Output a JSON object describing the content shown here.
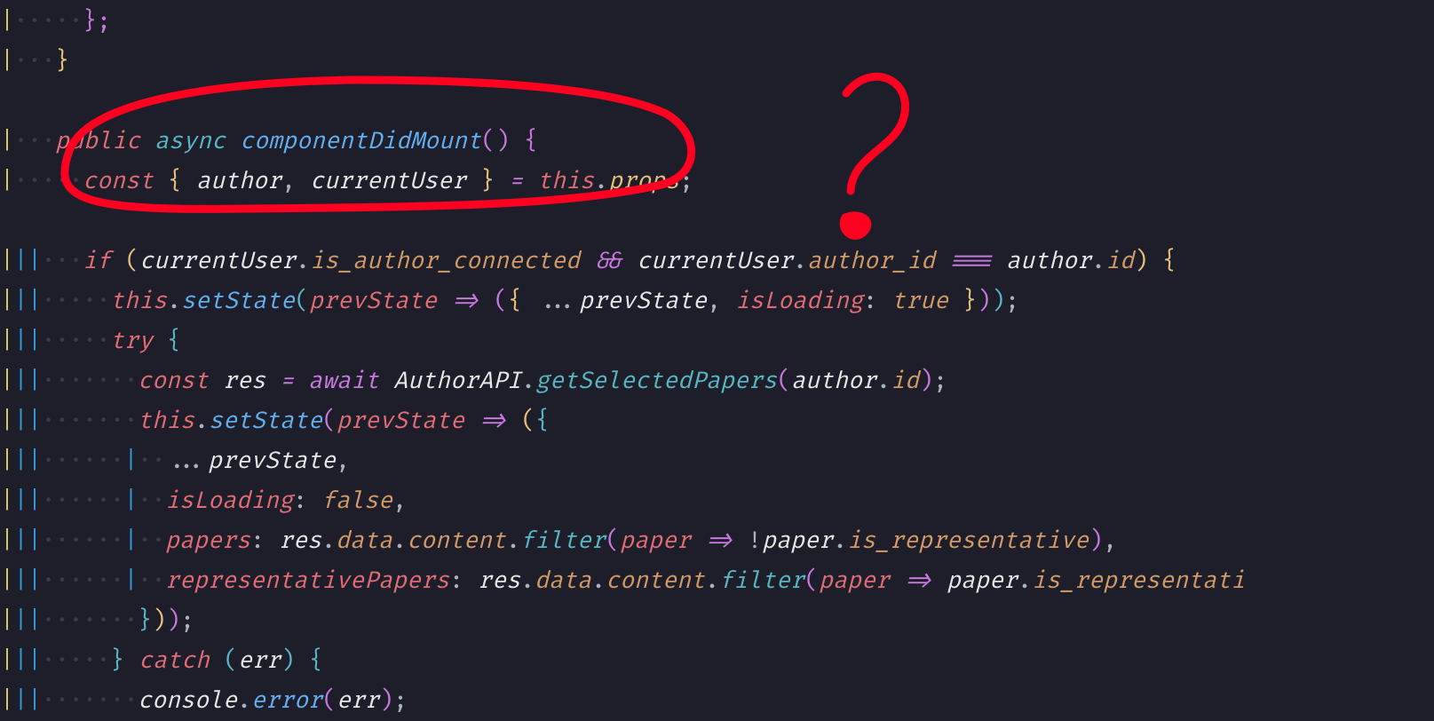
{
  "annotation": {
    "color": "#ff0020"
  },
  "code": {
    "lines": [
      {
        "indent": 3,
        "guides": "y   ",
        "tokens": [
          {
            "t": "};",
            "c": "brace-p"
          }
        ]
      },
      {
        "indent": 2,
        "guides": "y",
        "tokens": [
          {
            "t": "}",
            "c": "brace-y"
          }
        ]
      },
      {
        "indent": 0,
        "guides": "",
        "tokens": []
      },
      {
        "indent": 2,
        "guides": "y",
        "tokens": [
          {
            "t": "public",
            "c": "kw"
          },
          {
            "t": " ",
            "c": "plain"
          },
          {
            "t": "async",
            "c": "storage"
          },
          {
            "t": " ",
            "c": "plain"
          },
          {
            "t": "componentDidMount",
            "c": "fn"
          },
          {
            "t": "()",
            "c": "brace-p"
          },
          {
            "t": " ",
            "c": "plain"
          },
          {
            "t": "{",
            "c": "brace-p"
          }
        ]
      },
      {
        "indent": 3,
        "guides": "y   ",
        "tokens": [
          {
            "t": "const",
            "c": "kw"
          },
          {
            "t": " ",
            "c": "plain"
          },
          {
            "t": "{",
            "c": "brace-y"
          },
          {
            "t": " ",
            "c": "plain"
          },
          {
            "t": "author",
            "c": "white"
          },
          {
            "t": ",",
            "c": "punct"
          },
          {
            "t": " ",
            "c": "plain"
          },
          {
            "t": "currentUser",
            "c": "white"
          },
          {
            "t": " ",
            "c": "plain"
          },
          {
            "t": "}",
            "c": "brace-y"
          },
          {
            "t": " ",
            "c": "plain"
          },
          {
            "t": "=",
            "c": "kw2"
          },
          {
            "t": " ",
            "c": "plain"
          },
          {
            "t": "this",
            "c": "kw"
          },
          {
            "t": ".",
            "c": "punct"
          },
          {
            "t": "props",
            "c": "prop"
          },
          {
            "t": ";",
            "c": "punct"
          }
        ]
      },
      {
        "indent": 0,
        "guides": "",
        "tokens": []
      },
      {
        "indent": 3,
        "guides": "ybb ",
        "tokens": [
          {
            "t": "if",
            "c": "kw"
          },
          {
            "t": " ",
            "c": "plain"
          },
          {
            "t": "(",
            "c": "brace-y"
          },
          {
            "t": "currentUser",
            "c": "white"
          },
          {
            "t": ".",
            "c": "punct"
          },
          {
            "t": "is_author_connected",
            "c": "var"
          },
          {
            "t": " ",
            "c": "plain"
          },
          {
            "t": "&&",
            "c": "kw2"
          },
          {
            "t": " ",
            "c": "plain"
          },
          {
            "t": "currentUser",
            "c": "white"
          },
          {
            "t": ".",
            "c": "punct"
          },
          {
            "t": "author_id",
            "c": "var"
          },
          {
            "t": " ",
            "c": "plain"
          },
          {
            "t": "===",
            "c": "kw2"
          },
          {
            "t": " ",
            "c": "plain"
          },
          {
            "t": "author",
            "c": "white"
          },
          {
            "t": ".",
            "c": "punct"
          },
          {
            "t": "id",
            "c": "var"
          },
          {
            "t": ")",
            "c": "brace-y"
          },
          {
            "t": " ",
            "c": "plain"
          },
          {
            "t": "{",
            "c": "brace-y"
          }
        ]
      },
      {
        "indent": 4,
        "guides": "ybb     ",
        "tokens": [
          {
            "t": "this",
            "c": "kw"
          },
          {
            "t": ".",
            "c": "punct"
          },
          {
            "t": "setState",
            "c": "fn"
          },
          {
            "t": "(",
            "c": "brace-b"
          },
          {
            "t": "prevState",
            "c": "param"
          },
          {
            "t": " ",
            "c": "plain"
          },
          {
            "t": "=>",
            "c": "kw2"
          },
          {
            "t": " ",
            "c": "plain"
          },
          {
            "t": "(",
            "c": "brace-p"
          },
          {
            "t": "{",
            "c": "brace-y"
          },
          {
            "t": " ",
            "c": "plain"
          },
          {
            "t": "...",
            "c": "punct"
          },
          {
            "t": "prevState",
            "c": "white"
          },
          {
            "t": ",",
            "c": "punct"
          },
          {
            "t": " ",
            "c": "plain"
          },
          {
            "t": "isLoading",
            "c": "param"
          },
          {
            "t": ":",
            "c": "punct"
          },
          {
            "t": " ",
            "c": "plain"
          },
          {
            "t": "true",
            "c": "bool"
          },
          {
            "t": " ",
            "c": "plain"
          },
          {
            "t": "}",
            "c": "brace-y"
          },
          {
            "t": ")",
            "c": "brace-p"
          },
          {
            "t": ")",
            "c": "brace-b"
          },
          {
            "t": ";",
            "c": "punct"
          }
        ]
      },
      {
        "indent": 4,
        "guides": "ybb     ",
        "tokens": [
          {
            "t": "try",
            "c": "kw"
          },
          {
            "t": " ",
            "c": "plain"
          },
          {
            "t": "{",
            "c": "brace-b"
          }
        ]
      },
      {
        "indent": 5,
        "guides": "ybb       ",
        "tokens": [
          {
            "t": "const",
            "c": "kw"
          },
          {
            "t": " ",
            "c": "plain"
          },
          {
            "t": "res",
            "c": "white"
          },
          {
            "t": " ",
            "c": "plain"
          },
          {
            "t": "=",
            "c": "kw2"
          },
          {
            "t": " ",
            "c": "plain"
          },
          {
            "t": "await",
            "c": "kw2"
          },
          {
            "t": " ",
            "c": "plain"
          },
          {
            "t": "AuthorAPI",
            "c": "white"
          },
          {
            "t": ".",
            "c": "punct"
          },
          {
            "t": "getSelectedPapers",
            "c": "fn2"
          },
          {
            "t": "(",
            "c": "brace-p"
          },
          {
            "t": "author",
            "c": "white"
          },
          {
            "t": ".",
            "c": "punct"
          },
          {
            "t": "id",
            "c": "var"
          },
          {
            "t": ")",
            "c": "brace-p"
          },
          {
            "t": ";",
            "c": "punct"
          }
        ]
      },
      {
        "indent": 5,
        "guides": "ybb       ",
        "tokens": [
          {
            "t": "this",
            "c": "kw"
          },
          {
            "t": ".",
            "c": "punct"
          },
          {
            "t": "setState",
            "c": "fn"
          },
          {
            "t": "(",
            "c": "brace-p"
          },
          {
            "t": "prevState",
            "c": "param"
          },
          {
            "t": " ",
            "c": "plain"
          },
          {
            "t": "=>",
            "c": "kw2"
          },
          {
            "t": " ",
            "c": "plain"
          },
          {
            "t": "(",
            "c": "brace-y"
          },
          {
            "t": "{",
            "c": "brace-b"
          }
        ]
      },
      {
        "indent": 6,
        "guides": "ybb      b  ",
        "tokens": [
          {
            "t": "...",
            "c": "punct"
          },
          {
            "t": "prevState",
            "c": "white"
          },
          {
            "t": ",",
            "c": "punct"
          }
        ]
      },
      {
        "indent": 6,
        "guides": "ybb      b  ",
        "tokens": [
          {
            "t": "isLoading",
            "c": "param"
          },
          {
            "t": ":",
            "c": "punct"
          },
          {
            "t": " ",
            "c": "plain"
          },
          {
            "t": "false",
            "c": "bool"
          },
          {
            "t": ",",
            "c": "punct"
          }
        ]
      },
      {
        "indent": 6,
        "guides": "ybb      b  ",
        "tokens": [
          {
            "t": "papers",
            "c": "param"
          },
          {
            "t": ":",
            "c": "punct"
          },
          {
            "t": " ",
            "c": "plain"
          },
          {
            "t": "res",
            "c": "white"
          },
          {
            "t": ".",
            "c": "punct"
          },
          {
            "t": "data",
            "c": "var"
          },
          {
            "t": ".",
            "c": "punct"
          },
          {
            "t": "content",
            "c": "var"
          },
          {
            "t": ".",
            "c": "punct"
          },
          {
            "t": "filter",
            "c": "fn2"
          },
          {
            "t": "(",
            "c": "brace-p"
          },
          {
            "t": "paper",
            "c": "param"
          },
          {
            "t": " ",
            "c": "plain"
          },
          {
            "t": "=>",
            "c": "kw2"
          },
          {
            "t": " ",
            "c": "plain"
          },
          {
            "t": "!",
            "c": "punct"
          },
          {
            "t": "paper",
            "c": "white"
          },
          {
            "t": ".",
            "c": "punct"
          },
          {
            "t": "is_representative",
            "c": "var"
          },
          {
            "t": ")",
            "c": "brace-p"
          },
          {
            "t": ",",
            "c": "punct"
          }
        ]
      },
      {
        "indent": 6,
        "guides": "ybb      b  ",
        "tokens": [
          {
            "t": "representativePapers",
            "c": "param"
          },
          {
            "t": ":",
            "c": "punct"
          },
          {
            "t": " ",
            "c": "plain"
          },
          {
            "t": "res",
            "c": "white"
          },
          {
            "t": ".",
            "c": "punct"
          },
          {
            "t": "data",
            "c": "var"
          },
          {
            "t": ".",
            "c": "punct"
          },
          {
            "t": "content",
            "c": "var"
          },
          {
            "t": ".",
            "c": "punct"
          },
          {
            "t": "filter",
            "c": "fn2"
          },
          {
            "t": "(",
            "c": "brace-p"
          },
          {
            "t": "paper",
            "c": "param"
          },
          {
            "t": " ",
            "c": "plain"
          },
          {
            "t": "=>",
            "c": "kw2"
          },
          {
            "t": " ",
            "c": "plain"
          },
          {
            "t": "paper",
            "c": "white"
          },
          {
            "t": ".",
            "c": "punct"
          },
          {
            "t": "is_representati",
            "c": "var"
          }
        ]
      },
      {
        "indent": 5,
        "guides": "ybb       ",
        "tokens": [
          {
            "t": "}",
            "c": "brace-b"
          },
          {
            "t": ")",
            "c": "brace-y"
          },
          {
            "t": ")",
            "c": "brace-p"
          },
          {
            "t": ";",
            "c": "punct"
          }
        ]
      },
      {
        "indent": 4,
        "guides": "ybb     ",
        "tokens": [
          {
            "t": "}",
            "c": "brace-b"
          },
          {
            "t": " ",
            "c": "plain"
          },
          {
            "t": "catch",
            "c": "kw"
          },
          {
            "t": " ",
            "c": "plain"
          },
          {
            "t": "(",
            "c": "brace-b"
          },
          {
            "t": "err",
            "c": "white"
          },
          {
            "t": ")",
            "c": "brace-b"
          },
          {
            "t": " ",
            "c": "plain"
          },
          {
            "t": "{",
            "c": "brace-b"
          }
        ]
      },
      {
        "indent": 5,
        "guides": "ybb       ",
        "tokens": [
          {
            "t": "console",
            "c": "white"
          },
          {
            "t": ".",
            "c": "punct"
          },
          {
            "t": "error",
            "c": "fn"
          },
          {
            "t": "(",
            "c": "brace-p"
          },
          {
            "t": "err",
            "c": "white"
          },
          {
            "t": ")",
            "c": "brace-p"
          },
          {
            "t": ";",
            "c": "punct"
          }
        ]
      }
    ]
  }
}
